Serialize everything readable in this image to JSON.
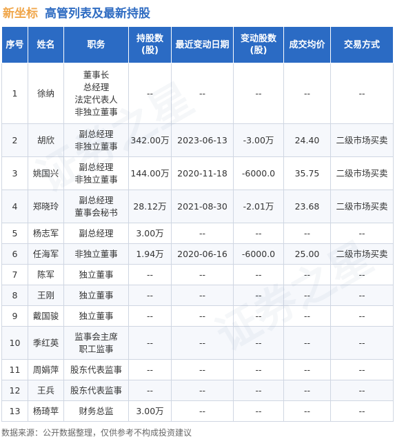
{
  "header": {
    "company": "新坐标",
    "title": "高管列表及最新持股"
  },
  "table": {
    "columns": [
      "序号",
      "姓名",
      "职务",
      "持股数\n(股)",
      "最近变动日期",
      "变动股数\n(股)",
      "成交均价",
      "交易方式"
    ],
    "rows": [
      {
        "no": "1",
        "name": "徐纳",
        "positions": [
          "董事长",
          "总经理",
          "法定代表人",
          "非独立董事"
        ],
        "shares": "--",
        "date": "--",
        "change": "--",
        "price": "--",
        "method": "--"
      },
      {
        "no": "2",
        "name": "胡欣",
        "positions": [
          "副总经理",
          "非独立董事"
        ],
        "shares": "342.00万",
        "date": "2023-06-13",
        "change": "-3.00万",
        "price": "24.40",
        "method": "二级市场买卖"
      },
      {
        "no": "3",
        "name": "姚国兴",
        "positions": [
          "副总经理",
          "非独立董事"
        ],
        "shares": "144.00万",
        "date": "2020-11-18",
        "change": "-6000.0",
        "price": "35.75",
        "method": "二级市场买卖"
      },
      {
        "no": "4",
        "name": "郑晓玲",
        "positions": [
          "副总经理",
          "董事会秘书"
        ],
        "shares": "28.12万",
        "date": "2021-08-30",
        "change": "-2.01万",
        "price": "23.68",
        "method": "二级市场买卖"
      },
      {
        "no": "5",
        "name": "杨志军",
        "positions": [
          "副总经理"
        ],
        "shares": "3.00万",
        "date": "--",
        "change": "--",
        "price": "--",
        "method": "--"
      },
      {
        "no": "6",
        "name": "任海军",
        "positions": [
          "非独立董事"
        ],
        "shares": "1.94万",
        "date": "2020-06-16",
        "change": "-6000.0",
        "price": "25.00",
        "method": "二级市场买卖"
      },
      {
        "no": "7",
        "name": "陈军",
        "positions": [
          "独立董事"
        ],
        "shares": "--",
        "date": "--",
        "change": "--",
        "price": "--",
        "method": "--"
      },
      {
        "no": "8",
        "name": "王刚",
        "positions": [
          "独立董事"
        ],
        "shares": "--",
        "date": "--",
        "change": "--",
        "price": "--",
        "method": "--"
      },
      {
        "no": "9",
        "name": "戴国骏",
        "positions": [
          "独立董事"
        ],
        "shares": "--",
        "date": "--",
        "change": "--",
        "price": "--",
        "method": "--"
      },
      {
        "no": "10",
        "name": "季红英",
        "positions": [
          "监事会主席",
          "职工监事"
        ],
        "shares": "--",
        "date": "--",
        "change": "--",
        "price": "--",
        "method": "--"
      },
      {
        "no": "11",
        "name": "周娟萍",
        "positions": [
          "股东代表监事"
        ],
        "shares": "--",
        "date": "--",
        "change": "--",
        "price": "--",
        "method": "--"
      },
      {
        "no": "12",
        "name": "王兵",
        "positions": [
          "股东代表监事"
        ],
        "shares": "--",
        "date": "--",
        "change": "--",
        "price": "--",
        "method": "--"
      },
      {
        "no": "13",
        "name": "杨琦苹",
        "positions": [
          "财务总监"
        ],
        "shares": "3.00万",
        "date": "--",
        "change": "--",
        "price": "--",
        "method": "--"
      }
    ]
  },
  "footer": {
    "source": "数据来源：公开数据整理，仅供参考不构成投资建议"
  },
  "watermark": {
    "text": "证券之星"
  },
  "colors": {
    "header_bg": "#2b6bc4",
    "company": "#f0a64a",
    "title": "#2f6cc2",
    "change": "#2a9a3a"
  }
}
